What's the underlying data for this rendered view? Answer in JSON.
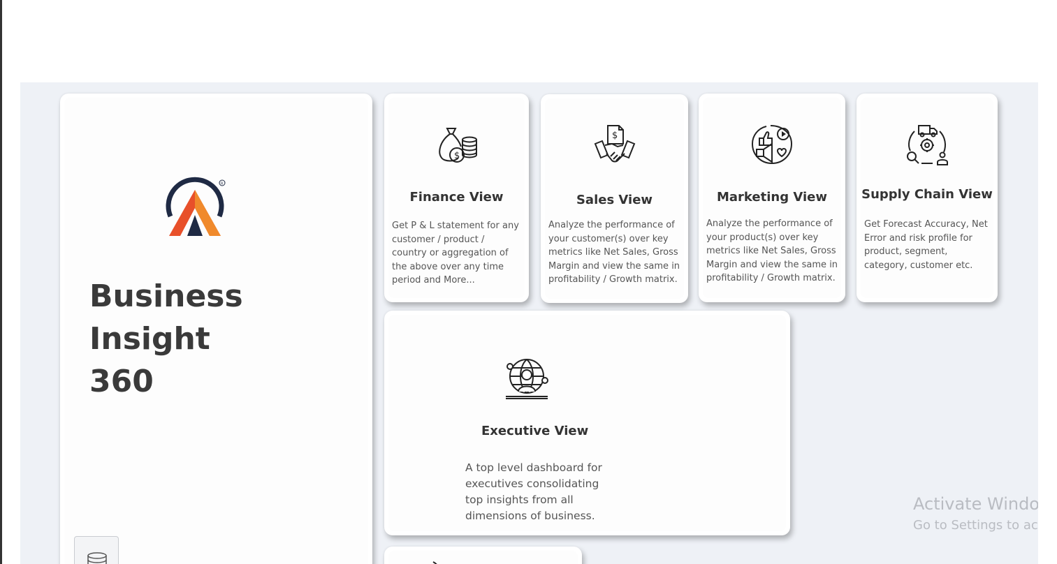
{
  "brand": {
    "title_line1": "Business Insight",
    "title_line2": "360",
    "logo_icon": "atliq-logo-icon",
    "logo_colors": [
      "#1f2a44",
      "#e8502a",
      "#f08a2c"
    ]
  },
  "views": {
    "finance": {
      "title": "Finance View",
      "description": "Get P & L statement for any customer / product / country or aggregation of the above over any time period and More...",
      "icon": "money-bag-coins-icon"
    },
    "sales": {
      "title": "Sales View",
      "description": "Analyze the performance of your customer(s) over key metrics like Net Sales, Gross Margin and view the same in profitability / Growth matrix.",
      "icon": "handshake-document-icon"
    },
    "marketing": {
      "title": "Marketing View",
      "description": "Analyze the performance of your product(s) over key metrics like Net Sales, Gross Margin and view the same in profitability / Growth matrix.",
      "icon": "megaphone-social-icon"
    },
    "supply_chain": {
      "title": "Supply Chain View",
      "description": "Get Forecast Accuracy, Net Error and risk profile for product, segment, category, customer etc.",
      "icon": "supply-chain-cycle-icon"
    },
    "executive": {
      "title": "Executive View",
      "description": "A top level dashboard for executives consolidating top insights from all dimensions of business.",
      "icon": "executive-globe-icon"
    }
  },
  "toolbar": {
    "data_button_icon": "database-icon"
  },
  "watermark": {
    "line1": "Activate Windows",
    "line2": "Go to Settings to activate Windows."
  },
  "colors": {
    "canvas_bg": "#eef1f6",
    "card_bg": "#ffffff",
    "title_text": "#333333",
    "body_text": "#555555"
  }
}
